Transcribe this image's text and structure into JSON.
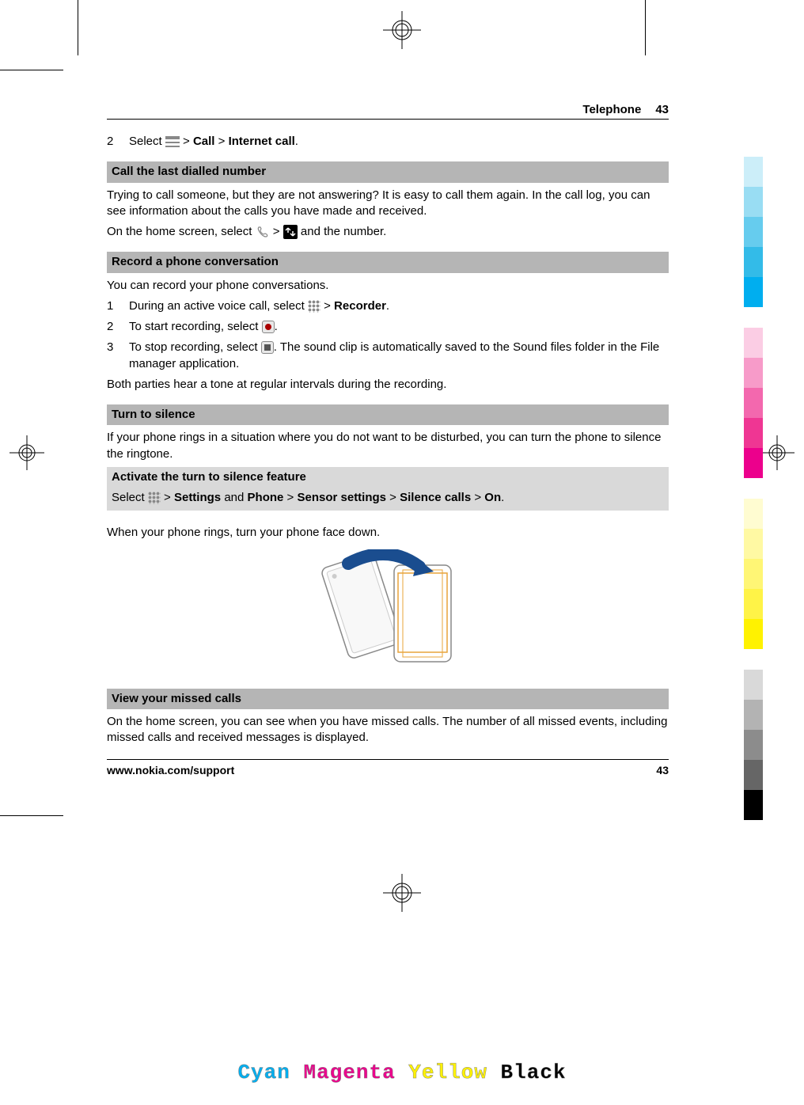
{
  "header": {
    "title": "Telephone",
    "page": "43"
  },
  "step2": {
    "num": "2",
    "pre": "Select ",
    "post": " > ",
    "bold1": "Call",
    "mid": " > ",
    "bold2": "Internet call",
    "end": "."
  },
  "sec1": {
    "title": "Call the last dialled number",
    "p1": "Trying to call someone, but they are not answering? It is easy to call them again. In the call log, you can see information about the calls you have made and received.",
    "p2a": "On the home screen, select ",
    "p2b": " > ",
    "p2c": " and the number."
  },
  "sec2": {
    "title": "Record a phone conversation",
    "p1": "You can record your phone conversations.",
    "s1": {
      "num": "1",
      "pre": "During an active voice call, select ",
      "mid": " > ",
      "bold": "Recorder",
      "end": "."
    },
    "s2": {
      "num": "2",
      "pre": "To start recording, select ",
      "end": "."
    },
    "s3": {
      "num": "3",
      "pre": "To stop recording, select ",
      "post": ". The sound clip is automatically saved to the Sound files folder in the File manager application."
    },
    "p2": "Both parties hear a tone at regular intervals during the recording."
  },
  "sec3": {
    "title": "Turn to silence",
    "p1": "If your phone rings in a situation where you do not want to be disturbed, you can turn the phone to silence the ringtone.",
    "sub_title": "Activate the turn to silence feature",
    "sub_pre": "Select ",
    "sub_mid": " > ",
    "sub_b1": "Settings",
    "sub_and": " and ",
    "sub_b2": "Phone",
    "sub_gt2": " > ",
    "sub_b3": "Sensor settings",
    "sub_gt3": " > ",
    "sub_b4": "Silence calls",
    "sub_gt4": " > ",
    "sub_b5": "On",
    "sub_end": ".",
    "p2": "When your phone rings, turn your phone face down."
  },
  "sec4": {
    "title": "View your missed calls",
    "p1": "On the home screen, you can see when you have missed calls. The number of all missed events, including missed calls and received messages is displayed."
  },
  "footer": {
    "url": "www.nokia.com/support",
    "page": "43"
  },
  "colors": {
    "cyan_bars": [
      "#cceef9",
      "#99ddf3",
      "#66ccee",
      "#33bbe8",
      "#00aeef"
    ],
    "magenta_bars": [
      "#fbcde4",
      "#f79bc9",
      "#f368ae",
      "#ef3693",
      "#ec008c"
    ],
    "yellow_bars": [
      "#fffcd1",
      "#fff9a3",
      "#fff675",
      "#fff347",
      "#fff200"
    ],
    "black_bars": [
      "#d9d9d9",
      "#b3b3b3",
      "#8c8c8c",
      "#666666",
      "#000000"
    ]
  },
  "color_words": {
    "c": "Cyan",
    "m": "Magenta",
    "y": "Yellow",
    "k": "Black"
  }
}
